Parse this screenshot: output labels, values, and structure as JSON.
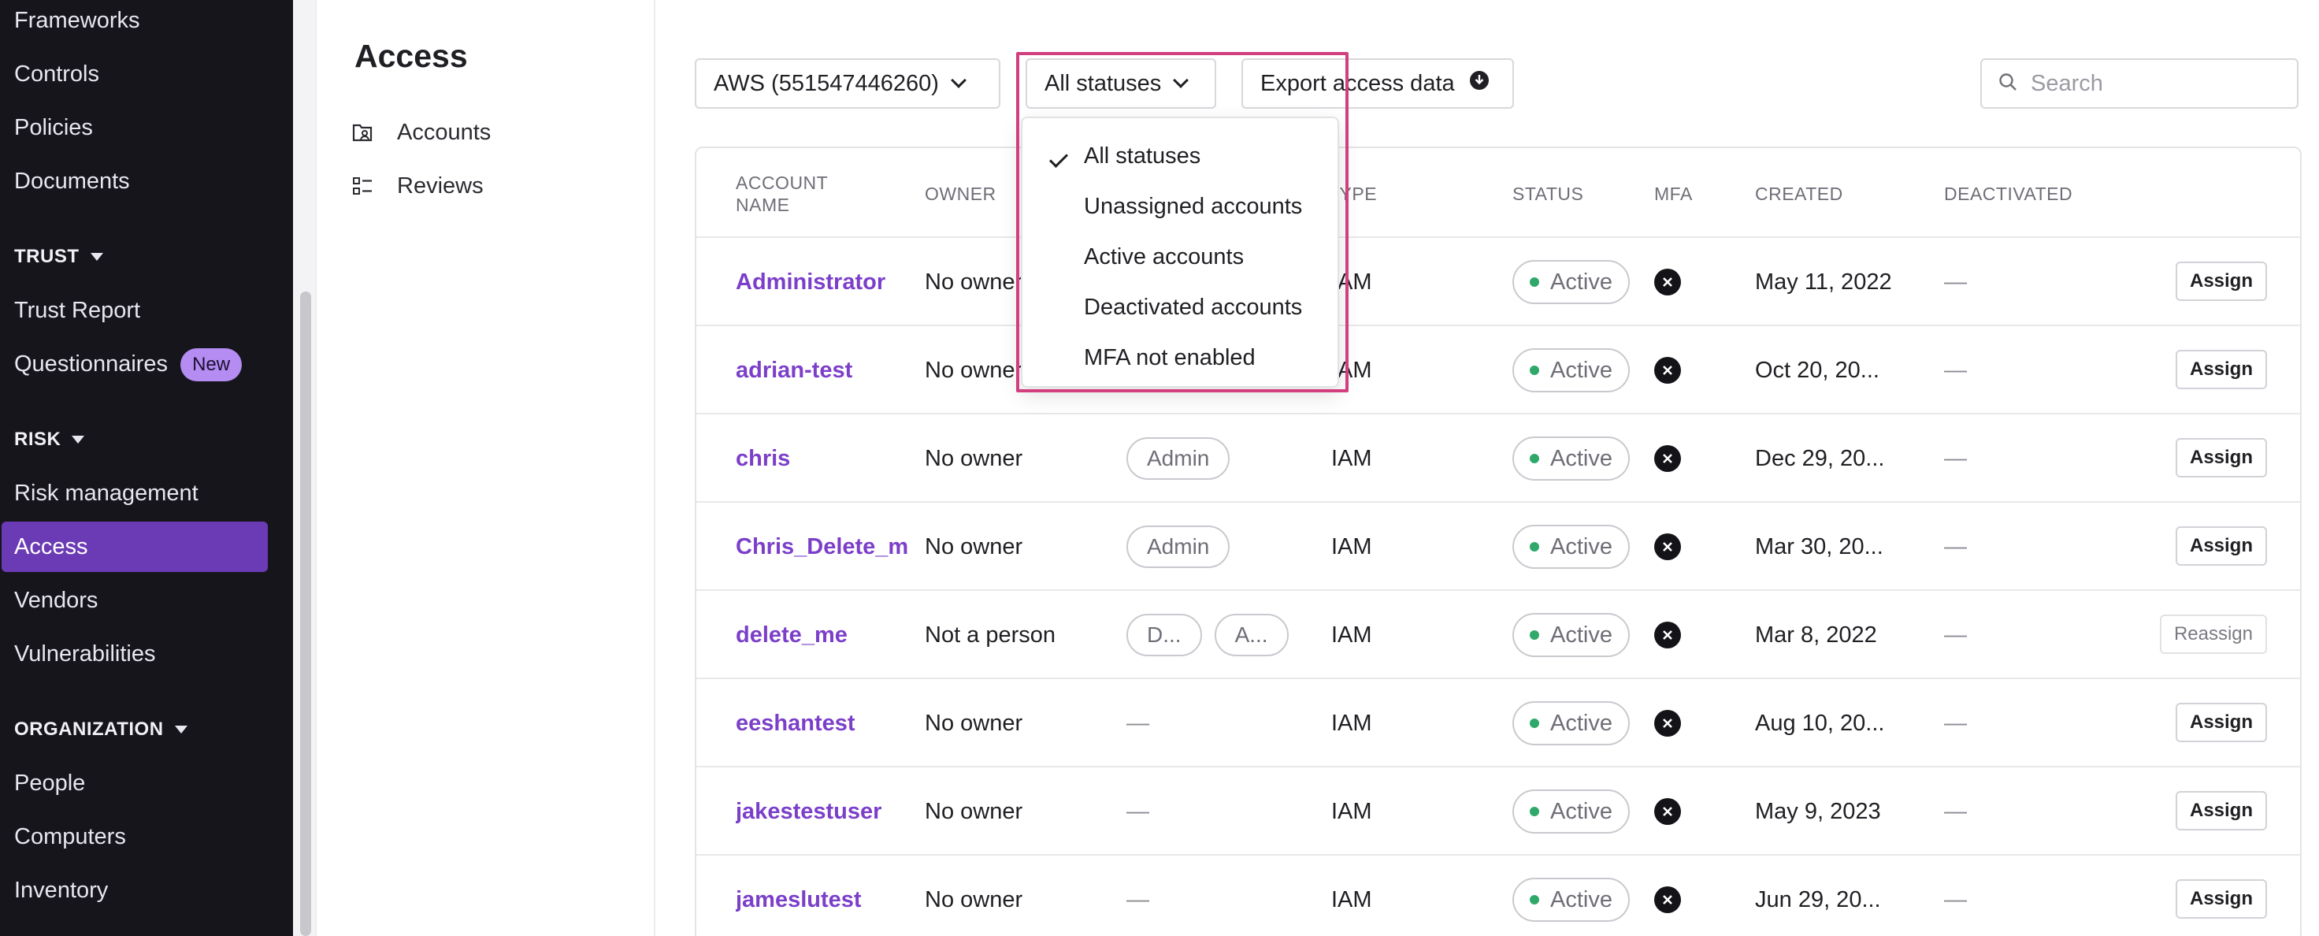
{
  "sidebar": {
    "items_top": [
      "Frameworks",
      "Controls",
      "Policies",
      "Documents"
    ],
    "trust": {
      "heading": "TRUST",
      "items": [
        "Trust Report",
        "Questionnaires"
      ],
      "badge": "New"
    },
    "risk": {
      "heading": "RISK",
      "items": [
        "Risk management",
        "Access",
        "Vendors",
        "Vulnerabilities"
      ],
      "active": "Access"
    },
    "organization": {
      "heading": "ORGANIZATION",
      "items": [
        "People",
        "Computers",
        "Inventory"
      ]
    }
  },
  "subnav": {
    "title": "Access",
    "items": [
      {
        "label": "Accounts",
        "icon": "accounts-icon"
      },
      {
        "label": "Reviews",
        "icon": "reviews-icon"
      }
    ]
  },
  "toolbar": {
    "account_select": "AWS (551547446260)",
    "status_select": "All statuses",
    "export_label": "Export access data",
    "search_placeholder": "Search"
  },
  "dropdown": {
    "selected": "All statuses",
    "options": [
      "All statuses",
      "Unassigned accounts",
      "Active accounts",
      "Deactivated accounts",
      "MFA not enabled"
    ]
  },
  "table": {
    "columns": [
      "ACCOUNT",
      "NAME",
      "OWNER",
      "TYPE",
      "STATUS",
      "MFA",
      "CREATED",
      "DEACTIVATED"
    ],
    "rows": [
      {
        "name": "Administrator",
        "owner": "No owner",
        "roles": [],
        "type": "IAM",
        "status": "Active",
        "created": "May 11, 2022",
        "deactivated": "—",
        "action": "Assign"
      },
      {
        "name": "adrian-test",
        "owner": "No owner",
        "roles": [],
        "type": "IAM",
        "status": "Active",
        "created": "Oct 20, 20...",
        "deactivated": "—",
        "action": "Assign"
      },
      {
        "name": "chris",
        "owner": "No owner",
        "roles": [
          "Admin"
        ],
        "type": "IAM",
        "status": "Active",
        "created": "Dec 29, 20...",
        "deactivated": "—",
        "action": "Assign"
      },
      {
        "name": "Chris_Delete_m",
        "owner": "No owner",
        "roles": [
          "Admin"
        ],
        "type": "IAM",
        "status": "Active",
        "created": "Mar 30, 20...",
        "deactivated": "—",
        "action": "Assign"
      },
      {
        "name": "delete_me",
        "owner": "Not a person",
        "roles": [
          "D...",
          "A..."
        ],
        "type": "IAM",
        "status": "Active",
        "created": "Mar 8, 2022",
        "deactivated": "—",
        "action": "Reassign"
      },
      {
        "name": "eeshantest",
        "owner": "No owner",
        "roles": [
          "—"
        ],
        "type": "IAM",
        "status": "Active",
        "created": "Aug 10, 20...",
        "deactivated": "—",
        "action": "Assign"
      },
      {
        "name": "jakestestuser",
        "owner": "No owner",
        "roles": [
          "—"
        ],
        "type": "IAM",
        "status": "Active",
        "created": "May 9, 2023",
        "deactivated": "—",
        "action": "Assign"
      },
      {
        "name": "jameslutest",
        "owner": "No owner",
        "roles": [
          "—"
        ],
        "type": "IAM",
        "status": "Active",
        "created": "Jun 29, 20...",
        "deactivated": "—",
        "action": "Assign"
      }
    ]
  },
  "colors": {
    "sidebar_bg": "#16151b",
    "active_nav": "#6b3bb5",
    "link": "#7b3fc9",
    "highlight": "#d23f7f",
    "status_dot": "#2fa86a"
  }
}
